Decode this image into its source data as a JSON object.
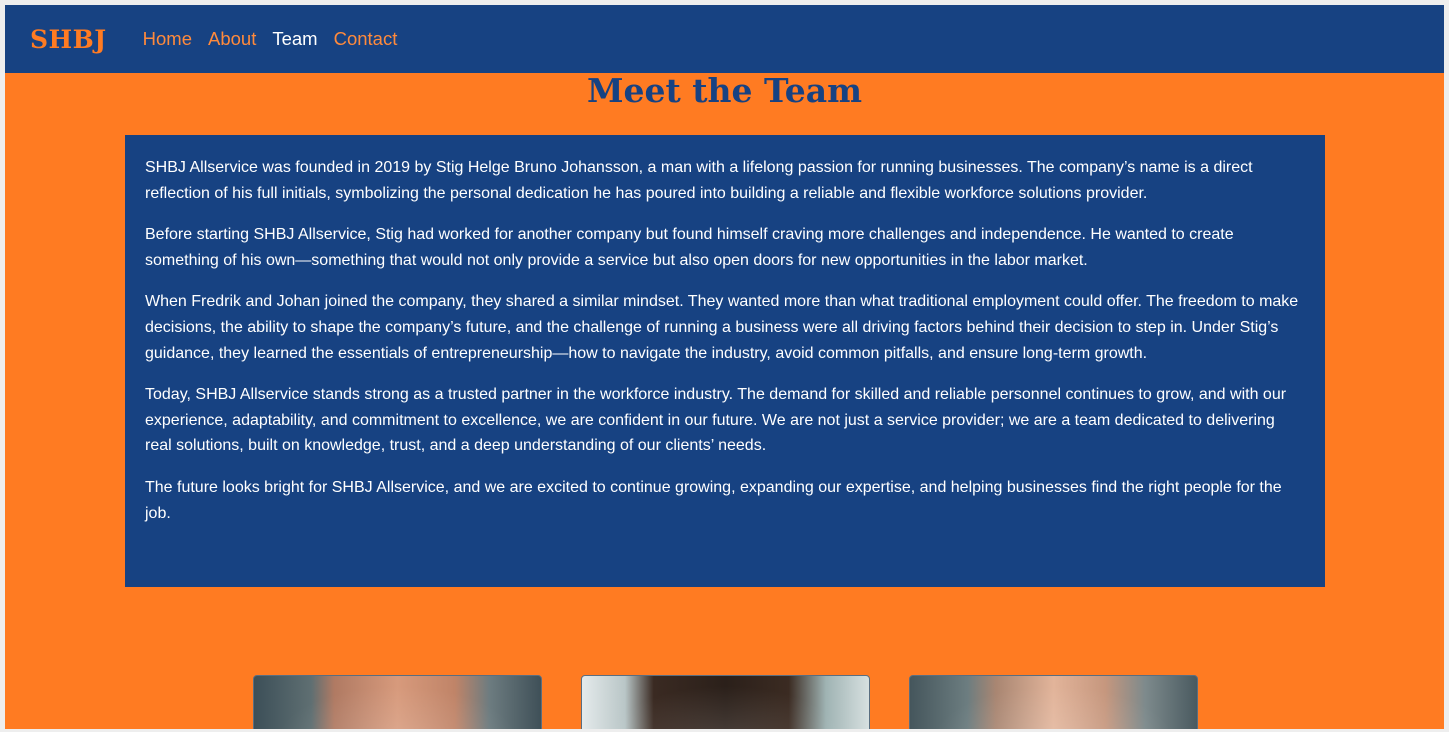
{
  "nav": {
    "logo": "SHBJ",
    "links": [
      {
        "label": "Home",
        "active": false
      },
      {
        "label": "About",
        "active": false
      },
      {
        "label": "Team",
        "active": true
      },
      {
        "label": "Contact",
        "active": false
      }
    ]
  },
  "page": {
    "title": "Meet the Team"
  },
  "about": {
    "paragraphs": [
      "SHBJ Allservice was founded in 2019 by Stig Helge Bruno Johansson, a man with a lifelong passion for running businesses. The company’s name is a direct reflection of his full initials, symbolizing the personal dedication he has poured into building a reliable and flexible workforce solutions provider.",
      "Before starting SHBJ Allservice, Stig had worked for another company but found himself craving more challenges and independence. He wanted to create something of his own—something that would not only provide a service but also open doors for new opportunities in the labor market.",
      "When Fredrik and Johan joined the company, they shared a similar mindset. They wanted more than what traditional employment could offer. The freedom to make decisions, the ability to shape the company’s future, and the challenge of running a business were all driving factors behind their decision to step in. Under Stig’s guidance, they learned the essentials of entrepreneurship—how to navigate the industry, avoid common pitfalls, and ensure long-term growth.",
      "Today, SHBJ Allservice stands strong as a trusted partner in the workforce industry. The demand for skilled and reliable personnel continues to grow, and with our experience, adaptability, and commitment to excellence, we are confident in our future. We are not just a service provider; we are a team dedicated to delivering real solutions, built on knowledge, trust, and a deep understanding of our clients’ needs.",
      "The future looks bright for SHBJ Allservice, and we are excited to continue growing, expanding our expertise, and helping businesses find the right people for the job."
    ]
  },
  "colors": {
    "navy": "#174282",
    "orange": "#ff7b22",
    "white": "#ffffff"
  }
}
